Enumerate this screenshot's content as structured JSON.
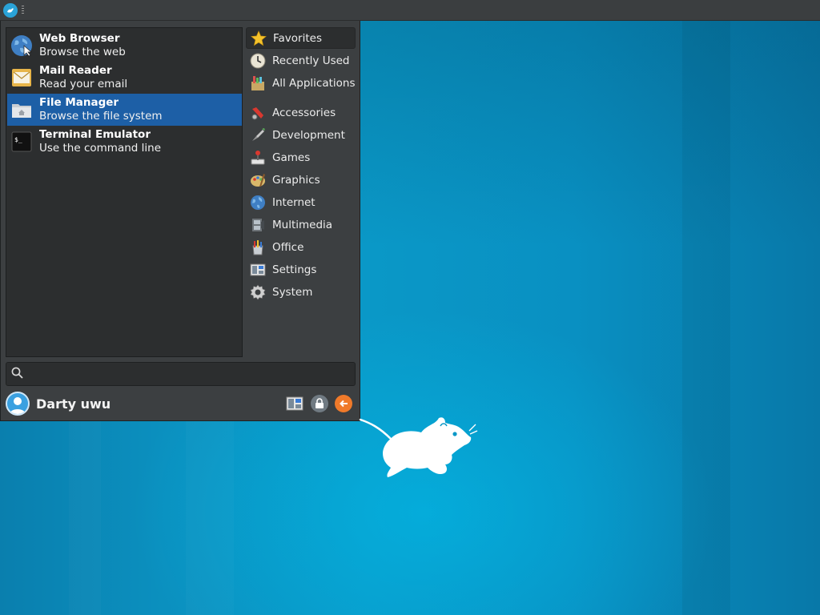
{
  "favorites": [
    {
      "title": "Web Browser",
      "subtitle": "Browse the web",
      "icon": "globe-icon"
    },
    {
      "title": "Mail Reader",
      "subtitle": "Read your email",
      "icon": "mail-icon"
    },
    {
      "title": "File Manager",
      "subtitle": "Browse the file system",
      "icon": "folder-home-icon",
      "selected": true
    },
    {
      "title": "Terminal Emulator",
      "subtitle": "Use the command line",
      "icon": "terminal-icon"
    }
  ],
  "categories": [
    {
      "label": "Favorites",
      "icon": "star-icon",
      "active": true
    },
    {
      "label": "Recently Used",
      "icon": "clock-icon"
    },
    {
      "label": "All Applications",
      "icon": "applications-icon"
    },
    {
      "label": "Accessories",
      "icon": "accessories-icon"
    },
    {
      "label": "Development",
      "icon": "development-icon"
    },
    {
      "label": "Games",
      "icon": "joystick-icon"
    },
    {
      "label": "Graphics",
      "icon": "palette-icon"
    },
    {
      "label": "Internet",
      "icon": "globe-icon"
    },
    {
      "label": "Multimedia",
      "icon": "film-icon"
    },
    {
      "label": "Office",
      "icon": "office-icon"
    },
    {
      "label": "Settings",
      "icon": "settings-icon"
    },
    {
      "label": "System",
      "icon": "gear-icon"
    }
  ],
  "search": {
    "placeholder": "",
    "value": ""
  },
  "user": {
    "name": "Darty uwu"
  },
  "colors": {
    "selection": "#1d5fa6",
    "menu_bg": "#3c3f41",
    "panel_bg": "#3b3e40",
    "desktop": "#0a98c7",
    "logout_accent": "#f07a2a"
  }
}
